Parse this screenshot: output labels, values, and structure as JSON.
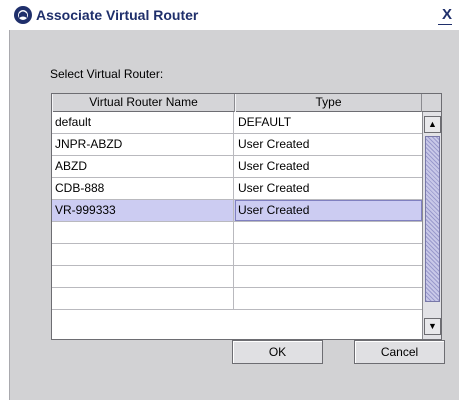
{
  "window": {
    "title": "Associate Virtual Router",
    "close_label": "X"
  },
  "dialog": {
    "select_label": "Select Virtual Router:",
    "columns": [
      "Virtual Router Name",
      "Type"
    ],
    "rows": [
      {
        "name": "default",
        "type": "DEFAULT",
        "selected": false
      },
      {
        "name": "JNPR-ABZD",
        "type": "User Created",
        "selected": false
      },
      {
        "name": "ABZD",
        "type": "User Created",
        "selected": false
      },
      {
        "name": "CDB-888",
        "type": "User Created",
        "selected": false
      },
      {
        "name": "VR-999333",
        "type": "User Created",
        "selected": true
      },
      {
        "name": "",
        "type": "",
        "selected": false
      },
      {
        "name": "",
        "type": "",
        "selected": false
      },
      {
        "name": "",
        "type": "",
        "selected": false
      },
      {
        "name": "",
        "type": "",
        "selected": false
      }
    ],
    "scroll_up_icon": "▲",
    "scroll_down_icon": "▼",
    "ok_label": "OK",
    "cancel_label": "Cancel"
  },
  "colors": {
    "title_text": "#1f2f6b",
    "dialog_bg": "#d2d2d4",
    "selection_bg": "#ccccf2"
  },
  "icons": {
    "app": "app-logo-icon",
    "close": "close-icon",
    "scroll_up": "scroll-up-arrow-icon",
    "scroll_down": "scroll-down-arrow-icon"
  }
}
